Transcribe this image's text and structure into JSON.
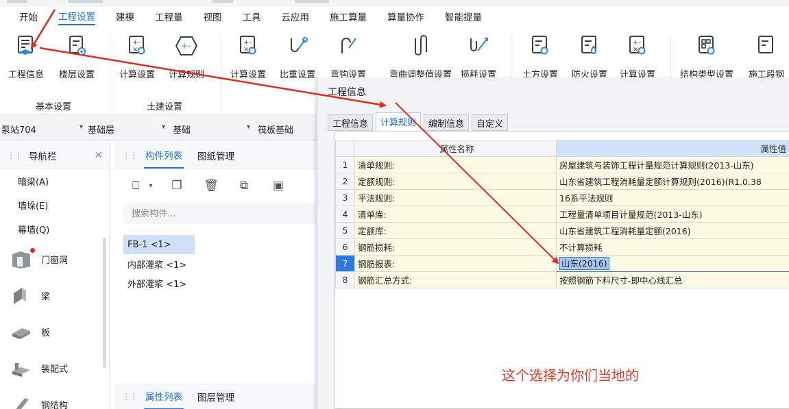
{
  "menu": {
    "items": [
      "开始",
      "工程设置",
      "建模",
      "工程量",
      "视图",
      "工具",
      "云应用",
      "施工算量",
      "算量协作",
      "智能提量"
    ],
    "active_index": 1
  },
  "ribbon": {
    "buttons": [
      {
        "label": "工程信息",
        "icon": "project-info-icon"
      },
      {
        "label": "楼层设置",
        "icon": "floor-settings-icon"
      },
      {
        "label": "计算设置",
        "icon": "calc-settings-icon"
      },
      {
        "label": "计算规则",
        "icon": "calc-rules-icon"
      },
      {
        "label": "计算设置",
        "icon": "calc-settings-icon"
      },
      {
        "label": "比重设置",
        "icon": "density-settings-icon"
      },
      {
        "label": "弯钩设置",
        "icon": "hook-settings-icon"
      },
      {
        "label": "弯曲调整值设置",
        "icon": "bend-adjust-icon"
      },
      {
        "label": "损耗设置",
        "icon": "loss-settings-icon"
      },
      {
        "label": "土方设置",
        "icon": "earthwork-settings-icon"
      },
      {
        "label": "防火设置",
        "icon": "fire-settings-icon"
      },
      {
        "label": "计算设置",
        "icon": "calc-settings-icon"
      },
      {
        "label": "结构类型设置",
        "icon": "structure-type-icon"
      },
      {
        "label": "施工段钢",
        "icon": "construction-stage-icon"
      }
    ],
    "groups": [
      "基本设置",
      "土建设置"
    ]
  },
  "levelbar": {
    "project": "泵站704",
    "floor": "基础层",
    "category": "基础",
    "type": "筏板基础"
  },
  "nav": {
    "title": "导航栏",
    "text_items": [
      "暗梁(A)",
      "墙垛(E)",
      "幕墙(Q)"
    ],
    "icon_items": [
      {
        "label": "门窗洞",
        "icon": "door-window-icon"
      },
      {
        "label": "梁",
        "icon": "beam-icon"
      },
      {
        "label": "板",
        "icon": "slab-icon"
      },
      {
        "label": "装配式",
        "icon": "prefab-icon"
      },
      {
        "label": "钢结构",
        "icon": "steel-structure-icon"
      }
    ]
  },
  "component_panel": {
    "tabs": [
      "构件列表",
      "图纸管理"
    ],
    "search_placeholder": "搜索构件...",
    "items": [
      "FB-1 <1>",
      "内部灌浆 <1>",
      "外部灌浆 <1>"
    ],
    "bottom_tabs": [
      "属性列表",
      "图层管理"
    ]
  },
  "dialog": {
    "title": "工程信息",
    "tabs": [
      "工程信息",
      "计算规则",
      "编制信息",
      "自定义"
    ],
    "active_tab": 1,
    "columns": [
      "属性名称",
      "属性值"
    ],
    "rows": [
      {
        "num": "1",
        "name": "清单规则:",
        "value": "房屋建筑与装饰工程计量规范计算规则(2013-山东)"
      },
      {
        "num": "2",
        "name": "定额规则:",
        "value": "山东省建筑工程消耗量定额计算规则(2016)(R1.0.38"
      },
      {
        "num": "3",
        "name": "平法规则:",
        "value": "16系平法规则"
      },
      {
        "num": "4",
        "name": "清单库:",
        "value": "工程量清单项目计量规范(2013-山东)"
      },
      {
        "num": "5",
        "name": "定额库:",
        "value": "山东省建筑工程消耗量定额(2016)"
      },
      {
        "num": "6",
        "name": "钢筋损耗:",
        "value": "不计算损耗"
      },
      {
        "num": "7",
        "name": "钢筋报表:",
        "value": "山东(2016)"
      },
      {
        "num": "8",
        "name": "钢筋汇总方式:",
        "value": "按照钢筋下料尺寸-即中心线汇总"
      }
    ],
    "selected_row": 6
  },
  "annotation": {
    "note": "这个选择为你们当地的",
    "color": "#e03a2a"
  },
  "colors": {
    "accent": "#1f6fe5",
    "selected_row": "#2f7ae0",
    "property_bg": "#fdfae3"
  }
}
